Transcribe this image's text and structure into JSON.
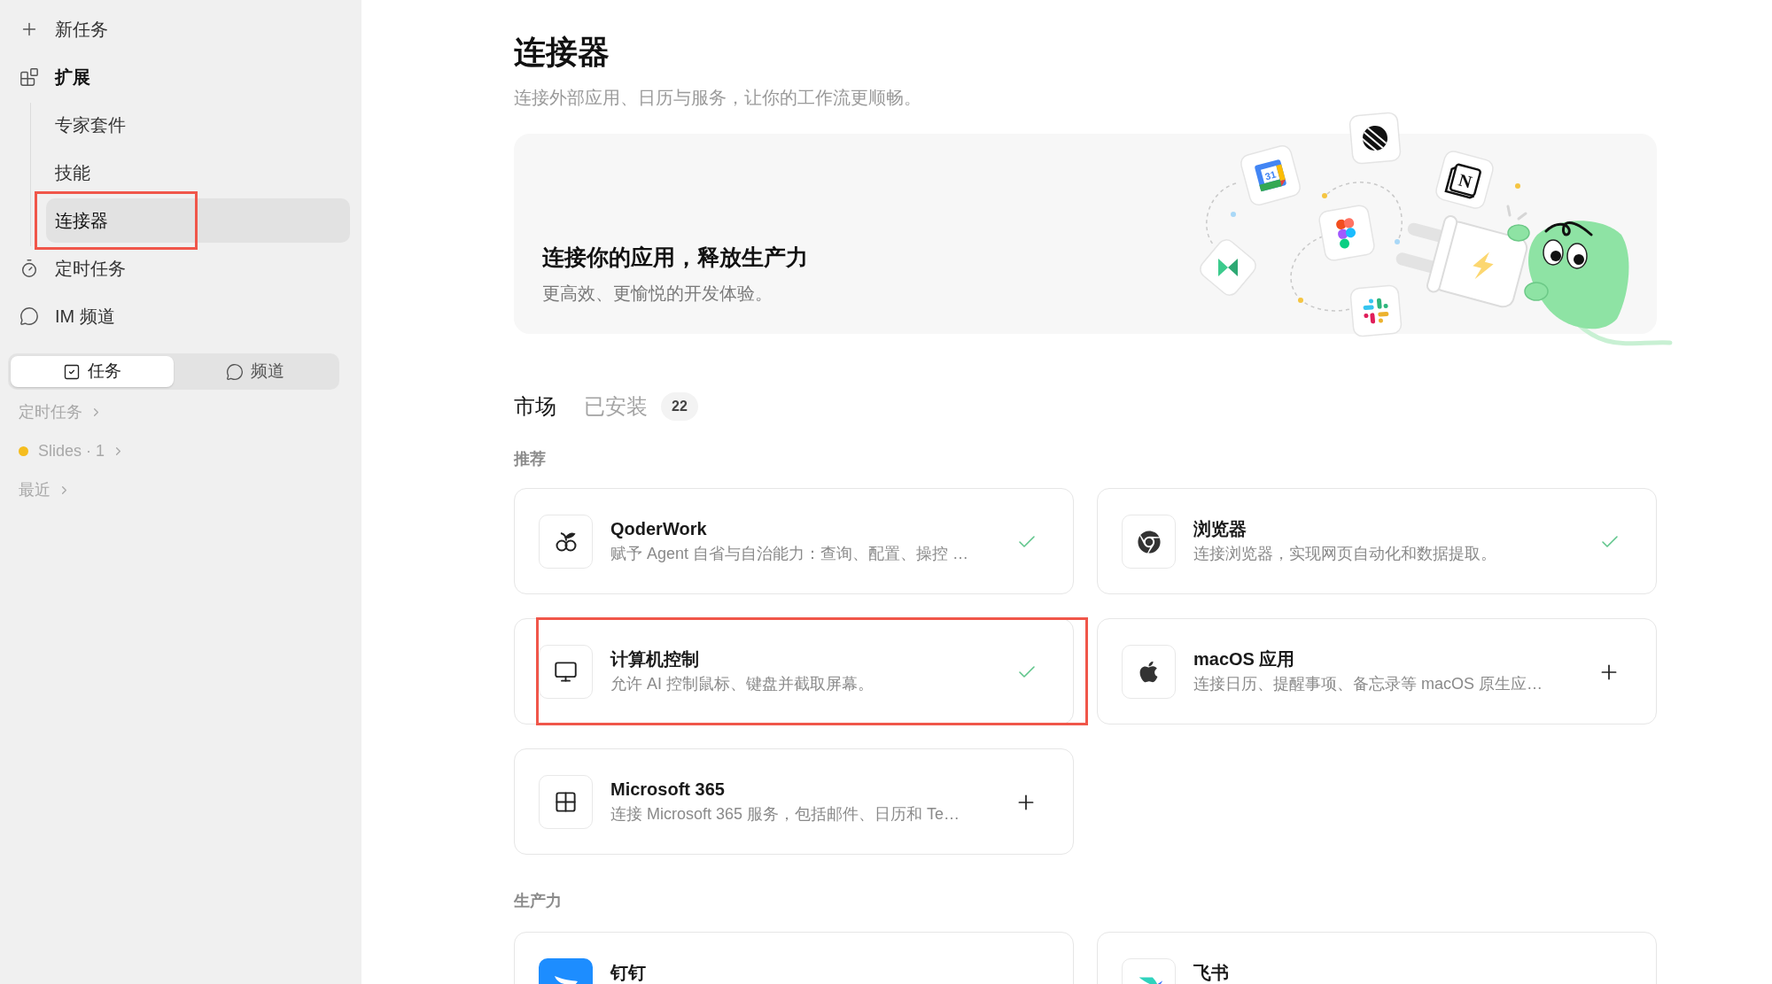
{
  "sidebar": {
    "items": [
      {
        "label": "新任务",
        "selected": false,
        "highlighted": false
      },
      {
        "label": "扩展",
        "selected": true,
        "highlighted": false,
        "children": [
          {
            "label": "专家套件",
            "selected": false,
            "highlighted": false
          },
          {
            "label": "技能",
            "selected": false,
            "highlighted": false
          },
          {
            "label": "连接器",
            "selected": true,
            "highlighted": true
          }
        ]
      },
      {
        "label": "定时任务",
        "selected": false,
        "highlighted": false
      },
      {
        "label": "IM 频道",
        "selected": false,
        "highlighted": false
      }
    ],
    "segments": [
      {
        "label": "任务",
        "selected": true
      },
      {
        "label": "频道",
        "selected": false
      }
    ],
    "groups": [
      {
        "label": "定时任务"
      },
      {
        "label": "Slides · 1",
        "color": "#f5bd1f"
      },
      {
        "label": "最近"
      }
    ]
  },
  "header": {
    "title": "连接器",
    "subtitle": "连接外部应用、日历与服务，让你的工作流更顺畅。"
  },
  "banner": {
    "title": "连接你的应用，释放生产力",
    "subtitle": "更高效、更愉悦的开发体验。",
    "art_labels": [
      "31",
      "N"
    ]
  },
  "tabs": [
    {
      "label": "市场",
      "selected": true
    },
    {
      "label": "已安装",
      "selected": false,
      "count": "22"
    }
  ],
  "sections": [
    {
      "title": "推荐",
      "cards": [
        {
          "name": "QoderWork",
          "description": "赋予 Agent 自省与自治能力：查询、配置、操控 …",
          "installed": true,
          "highlighted": false
        },
        {
          "name": "浏览器",
          "description": "连接浏览器，实现网页自动化和数据提取。",
          "installed": true,
          "highlighted": false
        },
        {
          "name": "计算机控制",
          "description": "允许 AI 控制鼠标、键盘并截取屏幕。",
          "installed": true,
          "highlighted": true
        },
        {
          "name": "macOS 应用",
          "description": "连接日历、提醒事项、备忘录等 macOS 原生应…",
          "installed": false,
          "highlighted": false
        },
        {
          "name": "Microsoft 365",
          "description": "连接 Microsoft 365 服务，包括邮件、日历和 Te…",
          "installed": false,
          "highlighted": false
        }
      ]
    },
    {
      "title": "生产力",
      "cards": [
        {
          "name": "钉钉",
          "highlighted": false
        },
        {
          "name": "飞书",
          "highlighted": false
        }
      ]
    }
  ]
}
